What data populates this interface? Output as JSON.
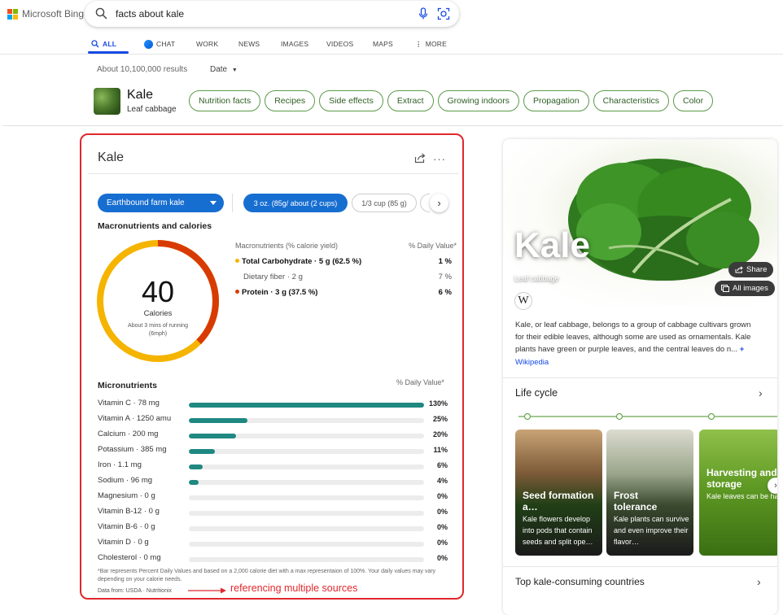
{
  "header": {
    "logo_text": "Microsoft Bing",
    "query": "facts about kale",
    "tabs": [
      {
        "label": "ALL"
      },
      {
        "label": "CHAT"
      },
      {
        "label": "WORK"
      },
      {
        "label": "NEWS"
      },
      {
        "label": "IMAGES"
      },
      {
        "label": "VIDEOS"
      },
      {
        "label": "MAPS"
      },
      {
        "label": "MORE"
      }
    ]
  },
  "results": {
    "count_text": "About 10,100,000 results",
    "date_filter": "Date"
  },
  "entity": {
    "name": "Kale",
    "subtitle": "Leaf cabbage",
    "chips": [
      "Nutrition facts",
      "Recipes",
      "Side effects",
      "Extract",
      "Growing indoors",
      "Propagation",
      "Characteristics",
      "Color"
    ]
  },
  "nutrition": {
    "title": "Kale",
    "brand": "Earthbound farm kale",
    "servings": [
      "3 oz. (85g/ about (2 cups)",
      "1/3 cup (85 g)"
    ],
    "macro_heading": "Macronutrients and calories",
    "calories": "40",
    "calories_label": "Calories",
    "calories_note": "About 3 mins of running (6mph)",
    "macro_col_head": "Macronutrients (% calorie yield)",
    "dv_head": "% Daily Value*",
    "macros": [
      {
        "label": "Total Carbohydrate · 5 g (62.5 %)",
        "dv": "1 %",
        "color": "#f5b400"
      },
      {
        "label": "Dietary fiber · 2 g",
        "dv": "7 %",
        "color": ""
      },
      {
        "label": "Protein · 3 g (37.5 %)",
        "dv": "6 %",
        "color": "#d83b01"
      }
    ],
    "ring_fractions": {
      "carbohydrate": 0.625,
      "protein": 0.375
    },
    "ring_colors": {
      "carbohydrate": "#f5b400",
      "protein": "#d83b01"
    },
    "micro_heading": "Micronutrients",
    "micro_dv_head": "% Daily Value*",
    "micros": [
      {
        "name": "Vitamin C · 78 mg",
        "pct": "130%",
        "fill": 1.0
      },
      {
        "name": "Vitamin A · 1250 amu",
        "pct": "25%",
        "fill": 0.25
      },
      {
        "name": "Calcium · 200 mg",
        "pct": "20%",
        "fill": 0.2
      },
      {
        "name": "Potassium · 385 mg",
        "pct": "11%",
        "fill": 0.11
      },
      {
        "name": "Iron · 1.1 mg",
        "pct": "6%",
        "fill": 0.06
      },
      {
        "name": "Sodium · 96 mg",
        "pct": "4%",
        "fill": 0.04
      },
      {
        "name": "Magnesium · 0 g",
        "pct": "0%",
        "fill": 0
      },
      {
        "name": "Vitamin B-12 · 0 g",
        "pct": "0%",
        "fill": 0
      },
      {
        "name": "Vitamin B-6 · 0 g",
        "pct": "0%",
        "fill": 0
      },
      {
        "name": "Vitamin D · 0 g",
        "pct": "0%",
        "fill": 0
      },
      {
        "name": "Cholesterol · 0 mg",
        "pct": "0%",
        "fill": 0
      }
    ],
    "bar_color": "#1e8881",
    "footnote": "*Bar represents Percent Daily Values and based on a 2,000 calorie diet with a max representaion of 100%. Your daily values may vary depending on your calorie needs.",
    "data_from": "Data from: USDA · Nutritionix",
    "annotation": "referencing multiple sources",
    "annotation_color": "#e0282d"
  },
  "panel": {
    "title": "Kale",
    "subtitle": "Leaf cabbage",
    "share_label": "Share",
    "all_images_label": "All images",
    "wiki_glyph": "W",
    "description": "Kale, or leaf cabbage, belongs to a group of cabbage cultivars grown for their edible leaves, although some are used as ornamentals. Kale plants have green or purple leaves, and the central leaves do n...",
    "more": "+",
    "source": "Wikipedia",
    "lifecycle_title": "Life cycle",
    "lifecycle": [
      {
        "title": "Seed formation a…",
        "desc": "Kale flowers develop into pods that contain seeds and split ope…"
      },
      {
        "title": "Frost tolerance",
        "desc": "Kale plants can survive and even improve their flavor…"
      },
      {
        "title": "Harvesting and storage",
        "desc": "Kale leaves can be harvested throughout the growing season and stored in the refrigerator or freezer"
      }
    ],
    "top_section": "Top kale-consuming countries"
  }
}
